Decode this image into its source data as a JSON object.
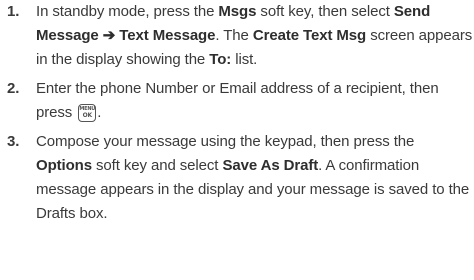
{
  "steps": [
    {
      "number": "1.",
      "t1": "In standby mode, press the ",
      "b1": "Msgs",
      "t2": " soft key, then select ",
      "b2": "Send Message",
      "arrow": "➔",
      "b3": "Text Message",
      "t3": ". The ",
      "b4": "Create Text Msg",
      "t4": " screen appears in the display showing the ",
      "b5": "To:",
      "t5": " list."
    },
    {
      "number": "2.",
      "t1": "Enter the phone Number or Email address of a recipient, then press ",
      "key_top": "MENU",
      "key_bottom": "OK",
      "key_icon": "menu-ok-key-icon",
      "t2": "."
    },
    {
      "number": "3.",
      "t1": "Compose your message using the keypad, then press the ",
      "b1": "Options",
      "t2": " soft key and select ",
      "b2": "Save As Draft",
      "t3": ". A confirmation message appears in the display and your message is saved to the Drafts box."
    }
  ]
}
